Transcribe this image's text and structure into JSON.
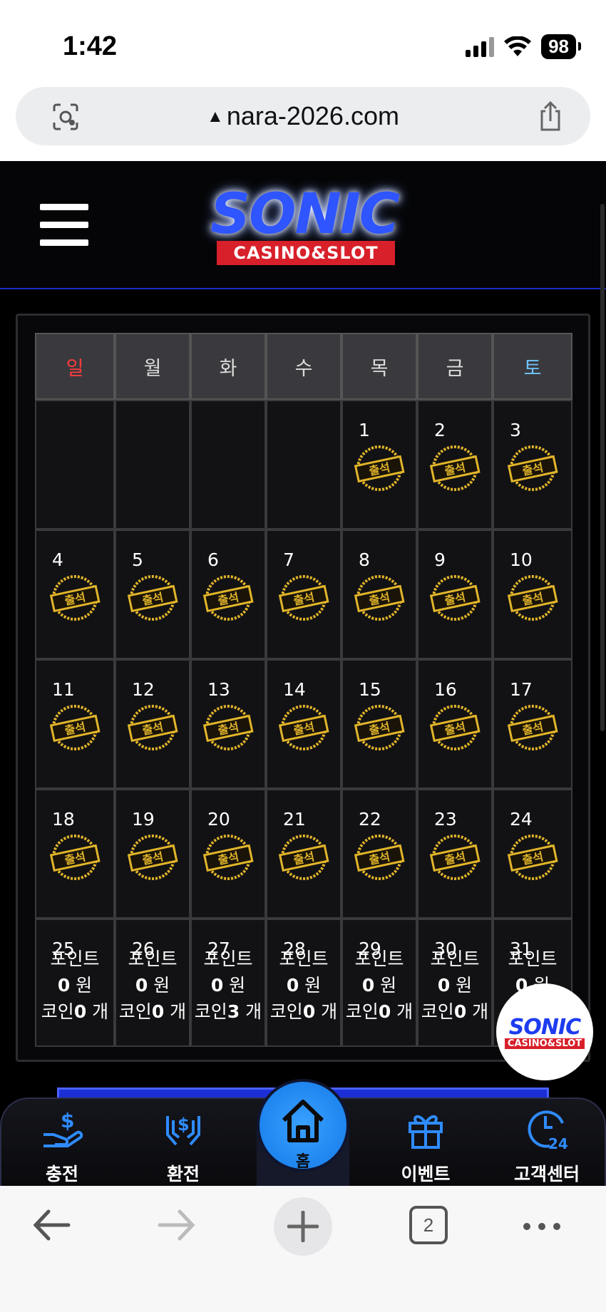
{
  "status_bar": {
    "time": "1:42",
    "battery": "98"
  },
  "browser": {
    "url": "nara-2026.com"
  },
  "site": {
    "logo_text": "SONIC",
    "logo_subtext": "CASINO&SLOT"
  },
  "calendar": {
    "weekdays": [
      "일",
      "월",
      "화",
      "수",
      "목",
      "금",
      "토"
    ],
    "stamp_label": "출석",
    "weeks": [
      [
        "",
        "",
        "",
        "",
        "1",
        "2",
        "3"
      ],
      [
        "4",
        "5",
        "6",
        "7",
        "8",
        "9",
        "10"
      ],
      [
        "11",
        "12",
        "13",
        "14",
        "15",
        "16",
        "17"
      ],
      [
        "18",
        "19",
        "20",
        "21",
        "22",
        "23",
        "24"
      ],
      [
        "25",
        "26",
        "27",
        "28",
        "29",
        "30",
        "31"
      ]
    ],
    "summary": [
      {
        "points_label": "포인트",
        "points_value": "0",
        "won": "원",
        "coin_label": "코인",
        "coin_value": "0",
        "unit": "개"
      },
      {
        "points_label": "포인트",
        "points_value": "0",
        "won": "원",
        "coin_label": "코인",
        "coin_value": "0",
        "unit": "개"
      },
      {
        "points_label": "포인트",
        "points_value": "0",
        "won": "원",
        "coin_label": "코인",
        "coin_value": "3",
        "unit": "개"
      },
      {
        "points_label": "포인트",
        "points_value": "0",
        "won": "원",
        "coin_label": "코인",
        "coin_value": "0",
        "unit": "개"
      },
      {
        "points_label": "포인트",
        "points_value": "0",
        "won": "원",
        "coin_label": "코인",
        "coin_value": "0",
        "unit": "개"
      },
      {
        "points_label": "포인트",
        "points_value": "0",
        "won": "원",
        "coin_label": "코인",
        "coin_value": "0",
        "unit": "개"
      },
      {
        "points_label": "포인트",
        "points_value": "0",
        "won": "원",
        "coin_label": "",
        "coin_value": "",
        "unit": ""
      }
    ]
  },
  "bottom_nav": {
    "charge": "충전",
    "exchange": "환전",
    "home": "홈",
    "event": "이벤트",
    "support": "고객센터"
  },
  "toolbar": {
    "tab_count": "2"
  },
  "colors": {
    "accent_blue": "#1f7ff0",
    "sunday": "#ff3b3b",
    "saturday": "#6ec3ff",
    "stamp_gold": "#e2b52a"
  }
}
